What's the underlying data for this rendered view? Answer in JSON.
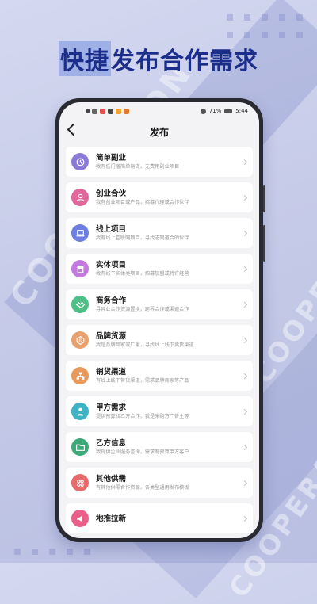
{
  "headline": {
    "part1": "快捷",
    "part2": "发布合作需求"
  },
  "background": {
    "watermark": "COOPERATION"
  },
  "status": {
    "battery": "71%",
    "time": "5:44"
  },
  "nav": {
    "title": "发布"
  },
  "colors": {
    "accent": "#1c2e8c",
    "highlight": "#9fb0e6"
  },
  "items": [
    {
      "title": "简单副业",
      "desc": "我有低门槛简单易做，无费用副业项目",
      "icon": "clock-icon",
      "color": "#8b7ad8"
    },
    {
      "title": "创业合伙",
      "desc": "我有创业项目或产品，招募代理或合作伙伴",
      "icon": "people-icon",
      "color": "#e0689a"
    },
    {
      "title": "线上项目",
      "desc": "我有线上互联网项目，寻找志同道合的伙伴",
      "icon": "laptop-icon",
      "color": "#6d7de0"
    },
    {
      "title": "实体项目",
      "desc": "我有线下实体类项目，招募加盟或特许经营",
      "icon": "store-icon",
      "color": "#c479e0"
    },
    {
      "title": "商务合作",
      "desc": "寻异业合作资源置换，跨界合作或渠道合作",
      "icon": "handshake-icon",
      "color": "#4fbf87"
    },
    {
      "title": "品牌货源",
      "desc": "我是品牌商家或厂家，寻找线上线下卖货渠道",
      "icon": "brand-icon",
      "color": "#e8a06c"
    },
    {
      "title": "销货渠道",
      "desc": "有线上线下带货渠道，需求品牌商家等产品",
      "icon": "network-icon",
      "color": "#e89a5c"
    },
    {
      "title": "甲方需求",
      "desc": "提供预算找乙方合作，我是采购方广告主等",
      "icon": "person-tie-icon",
      "color": "#3fb3c4"
    },
    {
      "title": "乙方信息",
      "desc": "我提供企业服务咨询，需求有预算甲方客户",
      "icon": "folder-icon",
      "color": "#3da878"
    },
    {
      "title": "其他供需",
      "desc": "有其他供需合作资源，各类型通用发布模板",
      "icon": "grid-icon",
      "color": "#e86b6b"
    },
    {
      "title": "地推拉新",
      "desc": "",
      "icon": "megaphone-icon",
      "color": "#e8608a"
    }
  ]
}
